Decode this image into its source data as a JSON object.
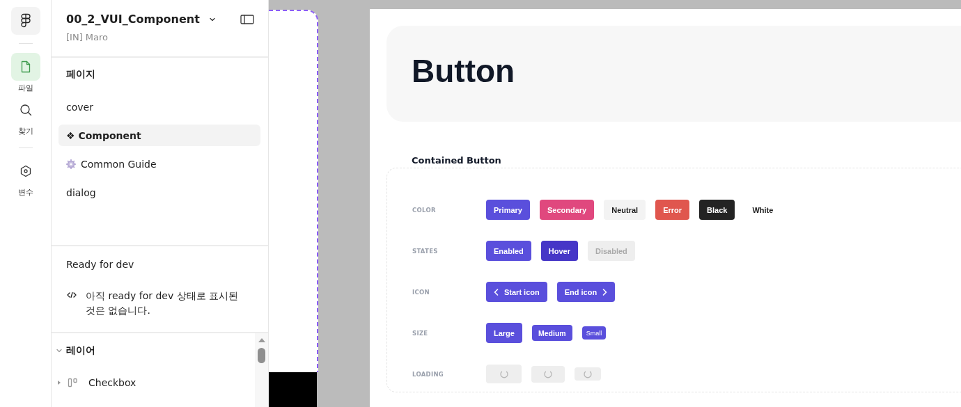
{
  "rail": {
    "items": [
      {
        "kind": "file",
        "label": "파일",
        "selected": true
      },
      {
        "kind": "search",
        "label": "찾기",
        "selected": false
      },
      {
        "kind": "variables",
        "label": "변수",
        "selected": false
      }
    ]
  },
  "panel": {
    "file_title": "00_2_VUI_Component",
    "team": "[IN] Maro",
    "pages_heading": "페이지",
    "pages": [
      {
        "label": "cover",
        "kind": "plain",
        "selected": false
      },
      {
        "label": "❖ Component",
        "kind": "plain",
        "selected": true
      },
      {
        "label": "Common Guide",
        "kind": "gear",
        "selected": false
      },
      {
        "label": "dialog",
        "kind": "plain",
        "selected": false
      }
    ],
    "ready_heading": "Ready for dev",
    "ready_message": "아직 ready for dev 상태로 표시된 것은 없습니다.",
    "layers_heading": "레이어",
    "layers": [
      {
        "label": "Checkbox",
        "expanded": false
      }
    ]
  },
  "canvas": {
    "title": "Button",
    "section_title": "Contained Button",
    "rows": [
      {
        "label": "COLOR",
        "buttons": [
          {
            "kind": "primary",
            "label": "Primary"
          },
          {
            "kind": "secondary",
            "label": "Secondary"
          },
          {
            "kind": "neutral",
            "label": "Neutral"
          },
          {
            "kind": "error",
            "label": "Error"
          },
          {
            "kind": "black",
            "label": "Black"
          },
          {
            "kind": "white",
            "label": "White"
          }
        ]
      },
      {
        "label": "STATES",
        "buttons": [
          {
            "kind": "primary",
            "label": "Enabled"
          },
          {
            "kind": "hover",
            "label": "Hover"
          },
          {
            "kind": "disabled",
            "label": "Disabled"
          }
        ]
      },
      {
        "label": "ICON",
        "buttons": [
          {
            "kind": "start-icon",
            "label": "Start icon"
          },
          {
            "kind": "end-icon",
            "label": "End icon"
          }
        ]
      },
      {
        "label": "SIZE",
        "buttons": [
          {
            "kind": "large",
            "label": "Large"
          },
          {
            "kind": "medium",
            "label": "Medium"
          },
          {
            "kind": "small",
            "label": "Small"
          }
        ]
      },
      {
        "label": "LOADING",
        "buttons": [
          {
            "kind": "loading-large"
          },
          {
            "kind": "loading-medium"
          },
          {
            "kind": "loading-small"
          }
        ]
      }
    ]
  }
}
